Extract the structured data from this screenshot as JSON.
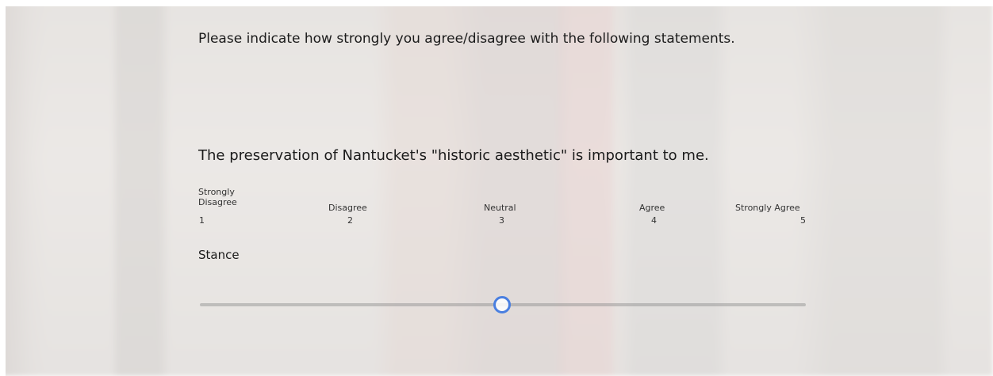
{
  "survey": {
    "instructions": "Please indicate how strongly you agree/disagree with the following statements.",
    "question": "The preservation of Nantucket's \"historic aesthetic\" is important to me.",
    "scale": {
      "labels": [
        "Strongly Disagree",
        "Disagree",
        "Neutral",
        "Agree",
        "Strongly Agree"
      ],
      "numbers": [
        "1",
        "2",
        "3",
        "4",
        "5"
      ]
    },
    "slider": {
      "label": "Stance",
      "min": 1,
      "max": 5,
      "value": 3,
      "accent_color": "#4a7fe0"
    }
  }
}
